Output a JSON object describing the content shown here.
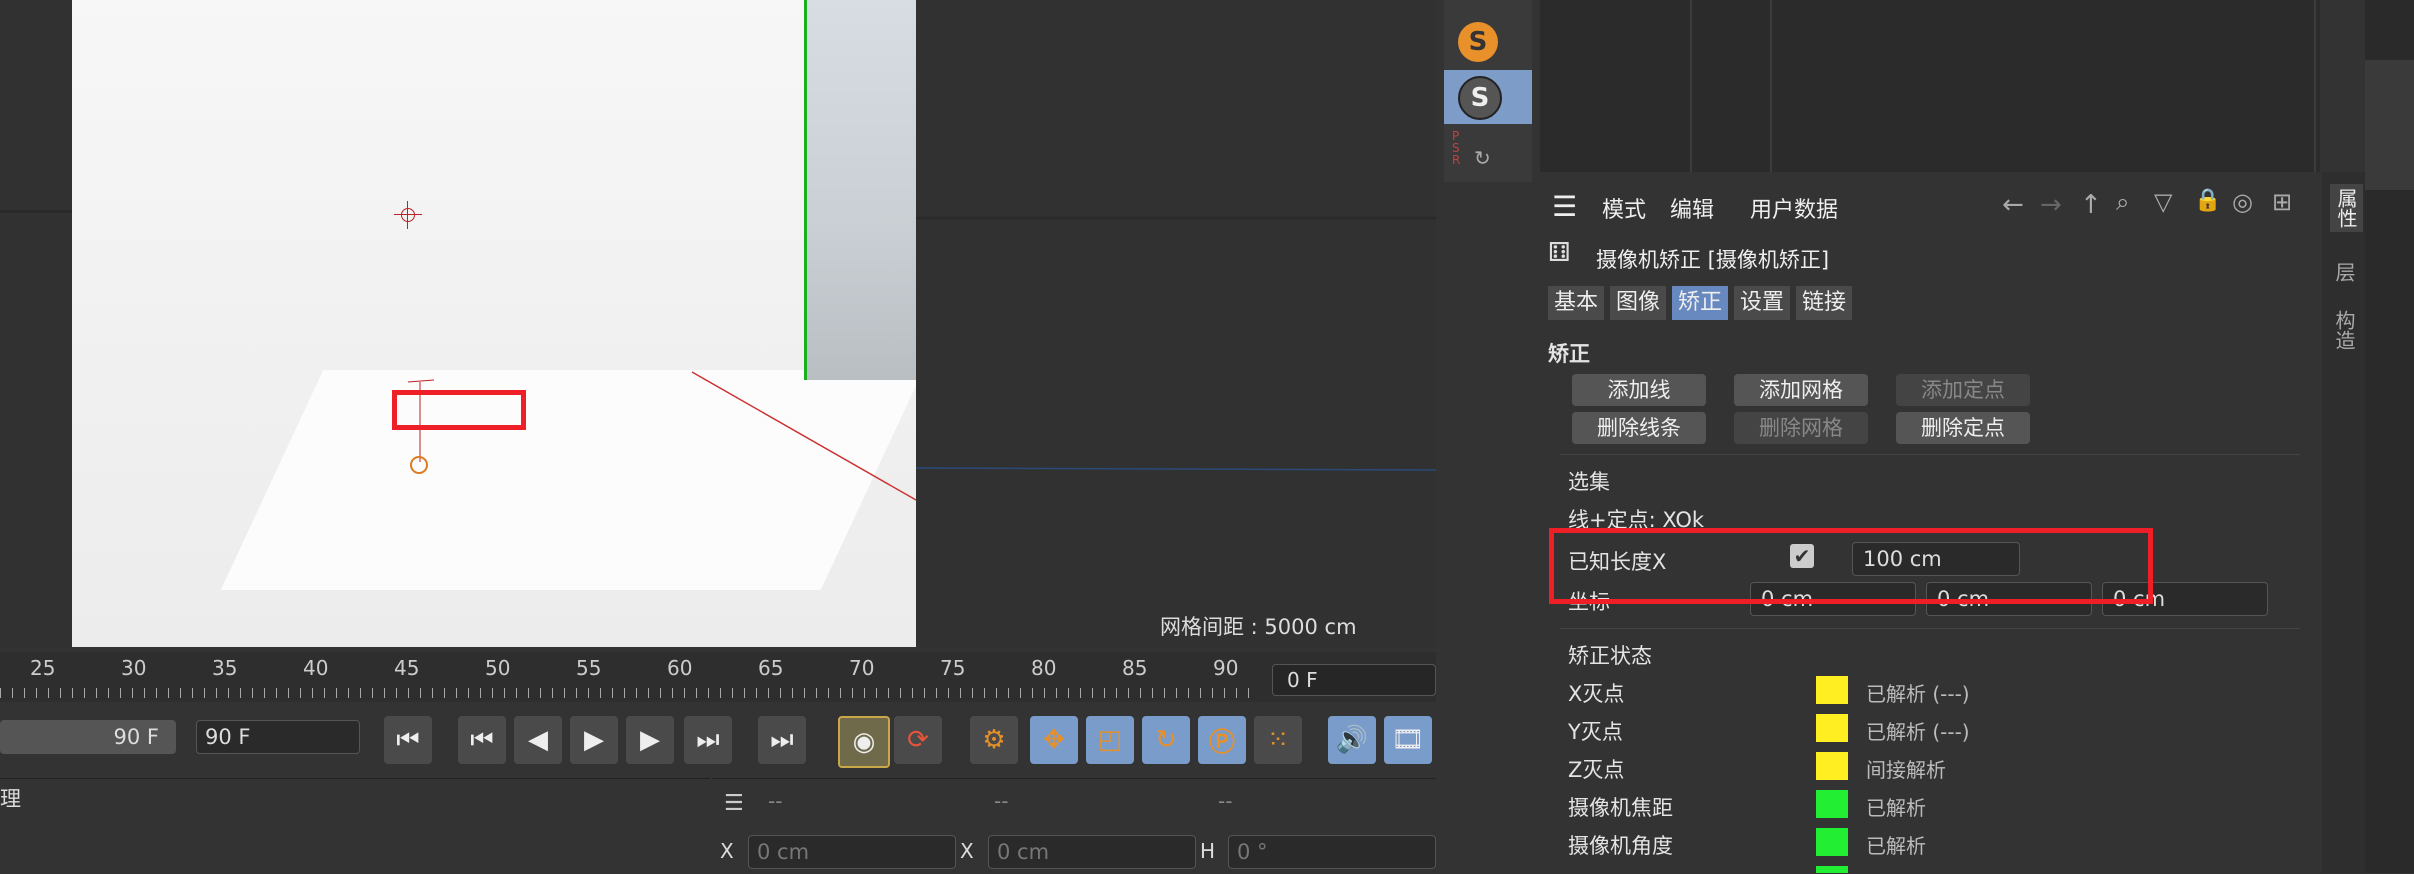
{
  "viewport": {
    "grid_label": "网格间距 : 5000 cm"
  },
  "timeline": {
    "ticks": [
      "25",
      "30",
      "35",
      "40",
      "45",
      "50",
      "55",
      "60",
      "65",
      "70",
      "75",
      "80",
      "85",
      "90"
    ],
    "frame_field": "0 F",
    "end_frame_left": "90 F",
    "end_frame_right": "90 F"
  },
  "bottom": {
    "objects_label": "理",
    "dashes": [
      "--",
      "--",
      "--"
    ],
    "coord_x1_label": "X",
    "coord_x1_value": "0 cm",
    "coord_x2_label": "X",
    "coord_x2_value": "0 cm",
    "coord_h_label": "H",
    "coord_h_value": "0 °"
  },
  "attr": {
    "menu": [
      "模式",
      "编辑",
      "用户数据"
    ],
    "title": "摄像机矫正 [摄像机矫正]",
    "tabs": [
      "基本",
      "图像",
      "矫正",
      "设置",
      "链接"
    ],
    "section": "矫正",
    "buttons": {
      "add_line": "添加线",
      "add_grid": "添加网格",
      "add_point": "添加定点",
      "del_lines": "删除线条",
      "del_grid": "删除网格",
      "del_point": "删除定点"
    },
    "selection_label": "选集",
    "line_point_label": "线+定点: XOk",
    "known_length_label": "已知长度X",
    "known_length_value": "100 cm",
    "coord_label": "坐标",
    "coord_values": [
      "0 cm",
      "0 cm",
      "0 cm"
    ],
    "status_section": "矫正状态",
    "status": [
      {
        "label": "X灭点",
        "text": "已解析 (---)",
        "color": "#ffee22"
      },
      {
        "label": "Y灭点",
        "text": "已解析 (---)",
        "color": "#ffee22"
      },
      {
        "label": "Z灭点",
        "text": "间接解析",
        "color": "#ffee22"
      },
      {
        "label": "摄像机焦距",
        "text": "已解析",
        "color": "#22ee33"
      },
      {
        "label": "摄像机角度",
        "text": "已解析",
        "color": "#22ee33"
      }
    ],
    "side_tabs": [
      "属性",
      "层",
      "构造"
    ]
  }
}
